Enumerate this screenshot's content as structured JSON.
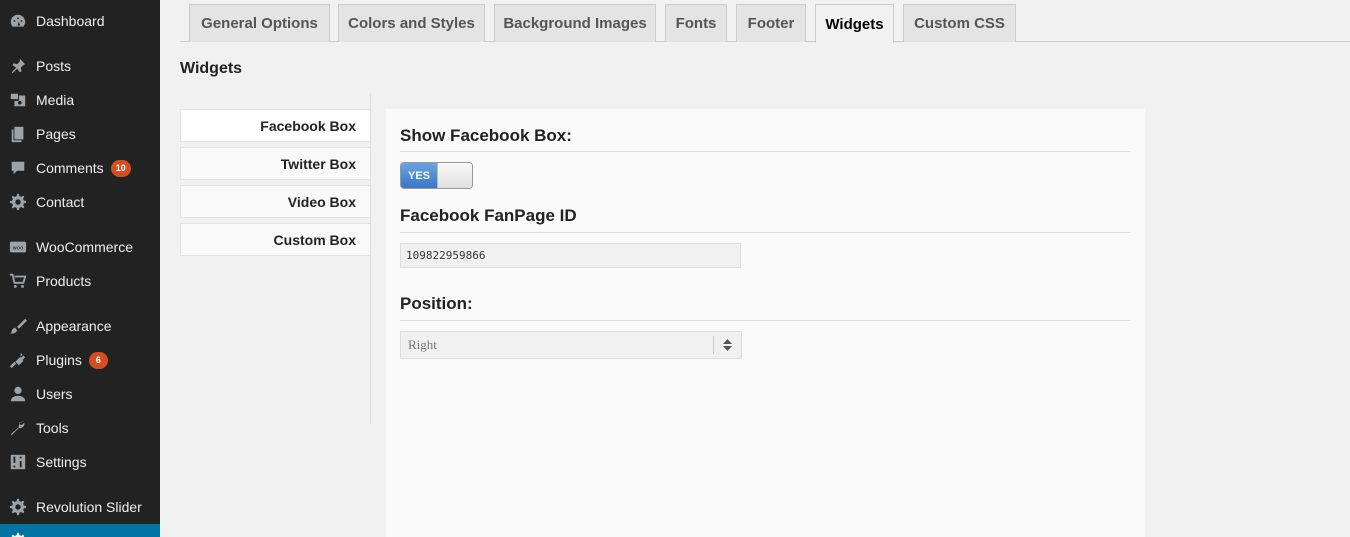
{
  "sidebar": {
    "items": [
      {
        "label": "Dashboard",
        "icon": "dashboard-icon"
      },
      {
        "label": "Posts",
        "icon": "pin-icon"
      },
      {
        "label": "Media",
        "icon": "media-icon"
      },
      {
        "label": "Pages",
        "icon": "pages-icon"
      },
      {
        "label": "Comments",
        "icon": "comment-icon",
        "badge": "10"
      },
      {
        "label": "Contact",
        "icon": "gear-icon"
      },
      {
        "label": "WooCommerce",
        "icon": "woocommerce-icon"
      },
      {
        "label": "Products",
        "icon": "cart-icon"
      },
      {
        "label": "Appearance",
        "icon": "paint-brush-icon"
      },
      {
        "label": "Plugins",
        "icon": "plug-icon",
        "badge": "6"
      },
      {
        "label": "Users",
        "icon": "user-icon"
      },
      {
        "label": "Tools",
        "icon": "wrench-icon"
      },
      {
        "label": "Settings",
        "icon": "settings-sliders-icon"
      },
      {
        "label": "Revolution Slider",
        "icon": "gear-icon"
      }
    ]
  },
  "tabs": [
    "General Options",
    "Colors and Styles",
    "Background Images",
    "Fonts",
    "Footer",
    "Widgets",
    "Custom CSS"
  ],
  "active_tab": "Widgets",
  "page_heading": "Widgets",
  "subtabs": [
    "Facebook Box",
    "Twitter Box",
    "Video Box",
    "Custom Box"
  ],
  "active_subtab": "Facebook Box",
  "panel": {
    "show_label": "Show Facebook Box:",
    "toggle_label": "YES",
    "fanpage_label": "Facebook FanPage ID",
    "fanpage_value": "109822959866",
    "position_label": "Position:",
    "position_value": "Right"
  },
  "colors": {
    "sidebar_bg": "#222222",
    "badge": "#d54e21",
    "toggle_on": "#3978c6",
    "current_menu": "#0074a2"
  }
}
